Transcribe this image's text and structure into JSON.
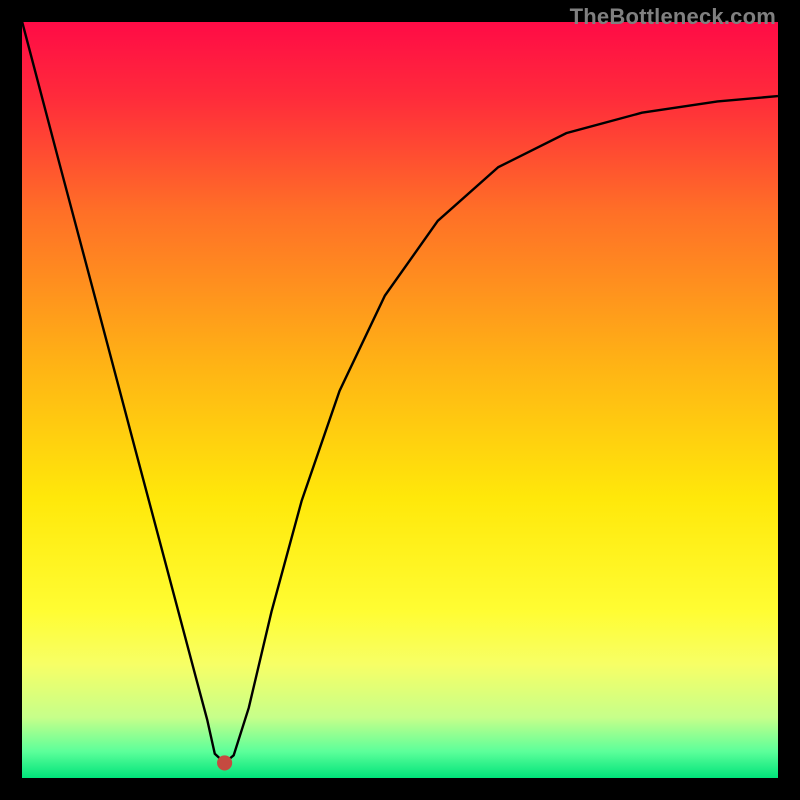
{
  "watermark": "TheBottleneck.com",
  "chart_data": {
    "type": "line",
    "title": "",
    "xlabel": "",
    "ylabel": "",
    "xlim": [
      0,
      100
    ],
    "ylim": [
      0,
      100
    ],
    "grid": false,
    "legend": false,
    "gradient_stops": [
      {
        "offset": 0.0,
        "color": "#ff0b46"
      },
      {
        "offset": 0.1,
        "color": "#ff2b3b"
      },
      {
        "offset": 0.25,
        "color": "#ff6f27"
      },
      {
        "offset": 0.45,
        "color": "#ffb215"
      },
      {
        "offset": 0.63,
        "color": "#ffe80a"
      },
      {
        "offset": 0.78,
        "color": "#fffd33"
      },
      {
        "offset": 0.85,
        "color": "#f7ff66"
      },
      {
        "offset": 0.92,
        "color": "#c6ff8a"
      },
      {
        "offset": 0.965,
        "color": "#5cff9a"
      },
      {
        "offset": 1.0,
        "color": "#00e37a"
      }
    ],
    "series": [
      {
        "name": "curve",
        "color": "#000000",
        "x": [
          -0.5,
          5,
          10,
          15,
          20,
          23,
          24.5,
          25.5,
          26.8,
          28,
          30,
          33,
          37,
          42,
          48,
          55,
          63,
          72,
          82,
          92,
          100
        ],
        "y": [
          102,
          81.1,
          62.3,
          43.4,
          24.6,
          13.3,
          7.7,
          3.2,
          2.0,
          3.0,
          9.3,
          22.0,
          36.7,
          51.2,
          63.8,
          73.7,
          80.8,
          85.3,
          88.0,
          89.5,
          90.2
        ]
      }
    ],
    "marker": {
      "x": 26.8,
      "y": 2.0,
      "r": 1.0,
      "color": "#c54a40"
    }
  }
}
